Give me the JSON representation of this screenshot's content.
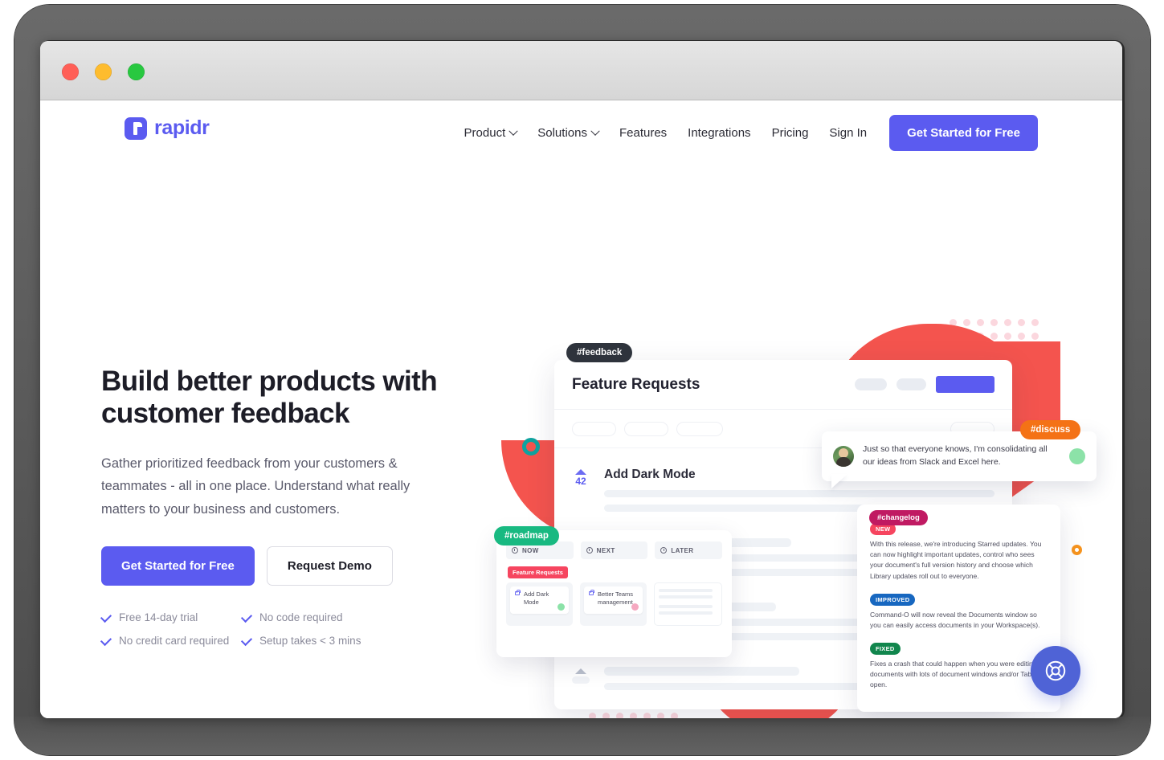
{
  "window": {
    "traffic_lights": [
      "close",
      "minimize",
      "zoom"
    ],
    "colors": {
      "close": "#ff5f57",
      "minimize": "#febc2e",
      "zoom": "#28c840"
    }
  },
  "brand": {
    "name": "rapidr",
    "color": "#5b5bf0"
  },
  "nav": {
    "links": [
      {
        "label": "Product",
        "has_dropdown": true
      },
      {
        "label": "Solutions",
        "has_dropdown": true
      },
      {
        "label": "Features",
        "has_dropdown": false
      },
      {
        "label": "Integrations",
        "has_dropdown": false
      },
      {
        "label": "Pricing",
        "has_dropdown": false
      },
      {
        "label": "Sign In",
        "has_dropdown": false
      }
    ],
    "cta_label": "Get Started for Free"
  },
  "hero": {
    "title": "Build better products with\ncustomer feedback",
    "subtitle": "Gather prioritized feedback from your customers & teammates - all in one place. Understand what really matters to your business and customers.",
    "primary_cta": "Get Started for Free",
    "secondary_cta": "Request Demo",
    "perks": [
      "Free 14-day trial",
      "No code required",
      "No credit card required",
      "Setup takes < 3 mins"
    ]
  },
  "tags": {
    "feedback": "#feedback",
    "roadmap": "#roadmap",
    "discuss": "#discuss",
    "changelog": "#changelog"
  },
  "feature_requests": {
    "title": "Feature Requests",
    "rows": [
      {
        "title": "Add Dark Mode",
        "votes": "42"
      },
      {
        "title": "",
        "votes": ""
      },
      {
        "title": "",
        "votes": ""
      },
      {
        "title": "",
        "votes": ""
      }
    ]
  },
  "roadmap": {
    "columns": [
      "NOW",
      "NEXT",
      "LATER"
    ],
    "group_label": "Feature Requests",
    "cards": [
      {
        "title": "Add Dark Mode",
        "status_color": "#8ce2a8"
      },
      {
        "title": "Better Teams management",
        "status_color": "#f5a8c0"
      },
      {
        "title": "",
        "status_color": ""
      }
    ]
  },
  "comment": {
    "text": "Just so that everyone knows, I'm consolidating all our ideas from Slack and Excel here.",
    "status_color": "#8ce2a8"
  },
  "changelog": {
    "entries": [
      {
        "badge": "NEW",
        "badge_color": "#f6455f",
        "text": "With this release, we're introducing Starred updates. You can now highlight important updates, control who sees your document's full version history and choose which Library updates roll out to everyone."
      },
      {
        "badge": "IMPROVED",
        "badge_color": "#1767c0",
        "text": "Command-O will now reveal the Documents window so you can easily access documents in your Workspace(s)."
      },
      {
        "badge": "FIXED",
        "badge_color": "#11864d",
        "text": "Fixes a crash that could happen when you were editing documents with lots of document windows and/or Tabs open."
      }
    ]
  },
  "help": {
    "icon": "lifebuoy-icon",
    "color": "#4f63d6"
  },
  "decor": {
    "dot_color": "#fbd7de",
    "blob_color": "#f4544e",
    "teal_ring": "#0fa3a0",
    "orange_ring": "#f7941e",
    "yellow_triangle": "#ffc63b"
  }
}
